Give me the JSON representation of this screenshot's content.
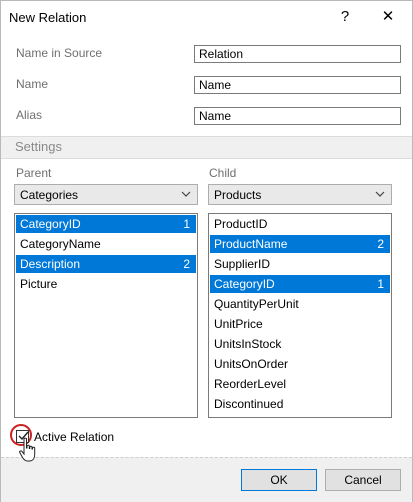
{
  "window": {
    "title": "New Relation",
    "help_glyph": "?",
    "close_glyph": "✕"
  },
  "fields": [
    {
      "label": "Name in Source",
      "value": "Relation"
    },
    {
      "label": "Name",
      "value": "Name"
    },
    {
      "label": "Alias",
      "value": "Name"
    }
  ],
  "settings": {
    "header": "Settings",
    "parent": {
      "label": "Parent",
      "selected": "Categories",
      "items": [
        {
          "text": "CategoryID",
          "order": "1",
          "selected": true
        },
        {
          "text": "CategoryName",
          "order": "",
          "selected": false
        },
        {
          "text": "Description",
          "order": "2",
          "selected": true
        },
        {
          "text": "Picture",
          "order": "",
          "selected": false
        }
      ]
    },
    "child": {
      "label": "Child",
      "selected": "Products",
      "items": [
        {
          "text": "ProductID",
          "order": "",
          "selected": false
        },
        {
          "text": "ProductName",
          "order": "2",
          "selected": true
        },
        {
          "text": "SupplierID",
          "order": "",
          "selected": false
        },
        {
          "text": "CategoryID",
          "order": "1",
          "selected": true
        },
        {
          "text": "QuantityPerUnit",
          "order": "",
          "selected": false
        },
        {
          "text": "UnitPrice",
          "order": "",
          "selected": false
        },
        {
          "text": "UnitsInStock",
          "order": "",
          "selected": false
        },
        {
          "text": "UnitsOnOrder",
          "order": "",
          "selected": false
        },
        {
          "text": "ReorderLevel",
          "order": "",
          "selected": false
        },
        {
          "text": "Discontinued",
          "order": "",
          "selected": false
        }
      ]
    }
  },
  "active_relation": {
    "label": "Active Relation",
    "checked": true
  },
  "buttons": {
    "ok": "OK",
    "cancel": "Cancel"
  },
  "colors": {
    "selection": "#0078d7",
    "focus_ring": "#cc1f1f"
  },
  "icons": {
    "dropdown": "chevron-down-icon",
    "cursor": "hand-pointer-icon"
  }
}
